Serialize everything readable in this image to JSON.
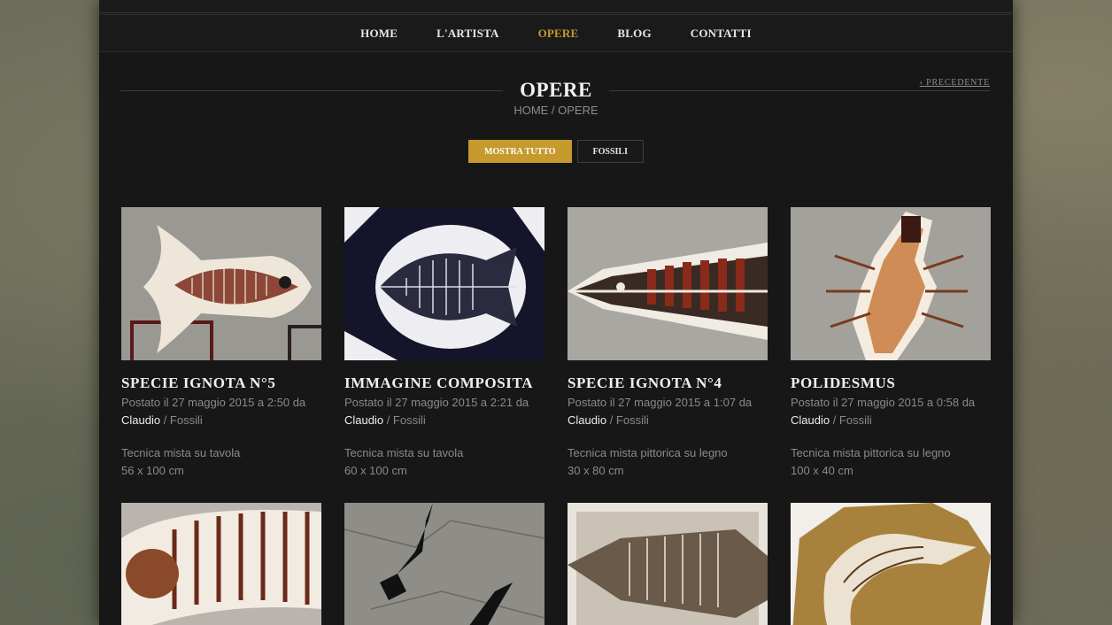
{
  "nav": {
    "items": [
      {
        "label": "HOME",
        "active": false
      },
      {
        "label": "L'ARTISTA",
        "active": false
      },
      {
        "label": "OPERE",
        "active": true
      },
      {
        "label": "BLOG",
        "active": false
      },
      {
        "label": "CONTATTI",
        "active": false
      }
    ]
  },
  "header": {
    "title": "OPERE",
    "breadcrumb": "HOME / OPERE",
    "prev_label": "‹ PRECEDENTE"
  },
  "filters": {
    "show_all": "MOSTRA TUTTO",
    "fossils": "FOSSILI"
  },
  "colors": {
    "accent": "#c69a2c",
    "page_bg": "#171717"
  },
  "works": [
    {
      "title": "SPECIE IGNOTA N°5",
      "posted": "Postato il 27 maggio 2015 a 2:50 da",
      "author": "Claudio",
      "category": " / Fossili",
      "technique": "Tecnica mista su tavola",
      "size": "56 x 100 cm"
    },
    {
      "title": "IMMAGINE COMPOSITA",
      "posted": "Postato il 27 maggio 2015 a 2:21 da",
      "author": "Claudio",
      "category": " / Fossili",
      "technique": "Tecnica mista su tavola",
      "size": "60 x 100 cm"
    },
    {
      "title": "SPECIE IGNOTA N°4",
      "posted": "Postato il 27 maggio 2015 a 1:07 da",
      "author": "Claudio",
      "category": " / Fossili",
      "technique": "Tecnica mista pittorica su legno",
      "size": "30 x 80 cm"
    },
    {
      "title": "POLIDESMUS",
      "posted": "Postato il 27 maggio 2015 a 0:58 da",
      "author": "Claudio",
      "category": " / Fossili",
      "technique": "Tecnica mista pittorica su legno",
      "size": "100 x 40 cm"
    }
  ]
}
